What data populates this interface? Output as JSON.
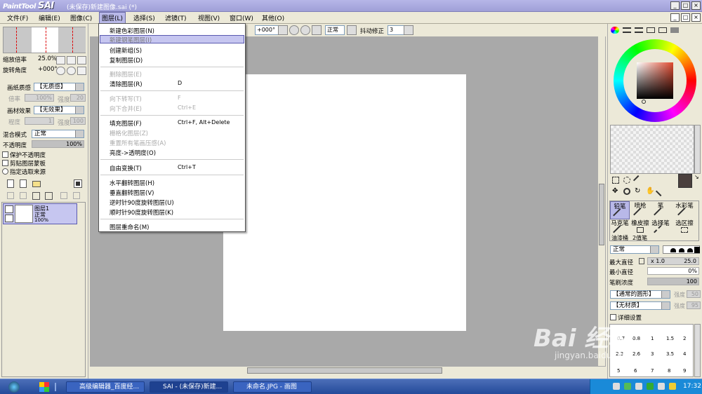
{
  "window": {
    "logo_small": "PaintTool",
    "logo_big": "SAI",
    "title": "(未保存)新建图像.sai (*)"
  },
  "menubar": {
    "items": [
      "文件(F)",
      "编辑(E)",
      "图像(C)",
      "图层(L)",
      "选择(S)",
      "滤镜(T)",
      "视图(V)",
      "窗口(W)",
      "其他(O)"
    ]
  },
  "toolbar": {
    "rotation": "+000°",
    "mode": "正常",
    "stabilizer_label": "抖动修正",
    "stabilizer_value": "3"
  },
  "left_panel": {
    "zoom_label": "缩放倍率",
    "zoom_value": "25.0%",
    "rotation_label": "旋转角度",
    "rotation_value": "+000°",
    "paper_texture_label": "画纸质感",
    "paper_texture_value": "【无质感】",
    "texture_rate_label": "倍率",
    "texture_rate_value": "100%",
    "texture_strength_label": "强度",
    "texture_strength_value": "20",
    "paper_effect_label": "画材效果",
    "paper_effect_value": "【无效果】",
    "effect_degree_label": "程度",
    "effect_degree_value": "1",
    "effect_strength_label": "强度",
    "effect_strength_value": "100",
    "blend_label": "混合模式",
    "blend_value": "正常",
    "opacity_label": "不透明度",
    "opacity_value": "100%",
    "checks": [
      "保护不透明度",
      "剪贴图层蒙板",
      "指定选取来源"
    ],
    "layer": {
      "name": "图层1",
      "mode": "正常",
      "opacity": "100%"
    }
  },
  "layer_menu": {
    "items": [
      {
        "label": "新建色彩图层(N)",
        "shortcut": "",
        "disabled": false,
        "highlight": false
      },
      {
        "label": "新建钢笔图层(I)",
        "shortcut": "",
        "disabled": false,
        "highlight": true
      },
      {
        "label": "创建新组(S)",
        "shortcut": "",
        "disabled": false,
        "highlight": false
      },
      {
        "label": "复制图层(D)",
        "shortcut": "",
        "disabled": false,
        "highlight": false
      },
      {
        "label": "删除图层(E)",
        "shortcut": "",
        "disabled": true,
        "highlight": false
      },
      {
        "label": "清除图层(R)",
        "shortcut": "D",
        "disabled": false,
        "highlight": false
      },
      {
        "label": "向下转写(T)",
        "shortcut": "F",
        "disabled": true,
        "highlight": false
      },
      {
        "label": "向下合并(E)",
        "shortcut": "Ctrl+E",
        "disabled": true,
        "highlight": false
      },
      {
        "label": "填充图层(F)",
        "shortcut": "Ctrl+F, Alt+Delete",
        "disabled": false,
        "highlight": false
      },
      {
        "label": "栅格化图层(Z)",
        "shortcut": "",
        "disabled": true,
        "highlight": false
      },
      {
        "label": "重置所有笔画压感(A)",
        "shortcut": "",
        "disabled": true,
        "highlight": false
      },
      {
        "label": "亮度->透明度(O)",
        "shortcut": "",
        "disabled": false,
        "highlight": false
      },
      {
        "label": "自由变换(T)",
        "shortcut": "Ctrl+T",
        "disabled": false,
        "highlight": false
      },
      {
        "label": "水平翻转图层(H)",
        "shortcut": "",
        "disabled": false,
        "highlight": false
      },
      {
        "label": "垂直翻转图层(V)",
        "shortcut": "",
        "disabled": false,
        "highlight": false
      },
      {
        "label": "逆时针90度旋转图层(U)",
        "shortcut": "",
        "disabled": false,
        "highlight": false
      },
      {
        "label": "顺时针90度旋转图层(K)",
        "shortcut": "",
        "disabled": false,
        "highlight": false
      },
      {
        "label": "图层重命名(M)",
        "shortcut": "",
        "disabled": false,
        "highlight": false
      }
    ]
  },
  "right_panel": {
    "tools": [
      "铅笔",
      "喷枪",
      "笔",
      "水彩笔",
      "马克笔",
      "橡皮擦",
      "选择笔",
      "选区擦",
      "油漆桶",
      "2值笔"
    ],
    "brush_mode": "正常",
    "max_size_label": "最大直径",
    "max_size_mult": "x 1.0",
    "max_size_value": "25.0",
    "min_size_label": "最小直径",
    "min_size_value": "0%",
    "density_label": "笔刷浓度",
    "density_value": "100",
    "shape_value": "【通常的圆形】",
    "shape_strength_label": "强度",
    "shape_strength_value": "50",
    "texture_value": "【无材质】",
    "texture_strength_label": "强度",
    "texture_strength_value": "95",
    "detail_label": "详细设置",
    "sizes": [
      "0.7",
      "0.8",
      "1",
      "1.5",
      "2",
      "2.3",
      "2.6",
      "3",
      "3.5",
      "4",
      "5",
      "6",
      "7",
      "8",
      "9"
    ]
  },
  "taskbar": {
    "tasks": [
      "高级编辑器_百度经...",
      "SAI - (未保存)新建...",
      "未命名.JPG - 画图"
    ],
    "clock": "17:32"
  },
  "watermark": {
    "brand": "Bai 经验",
    "url": "jingyan.baidu.com"
  },
  "colors": {
    "accent": "#b8b8e8",
    "title": "#a8a8e0",
    "canvas_bg": "#a9a9a9",
    "taskbar": "#2d55a8"
  }
}
